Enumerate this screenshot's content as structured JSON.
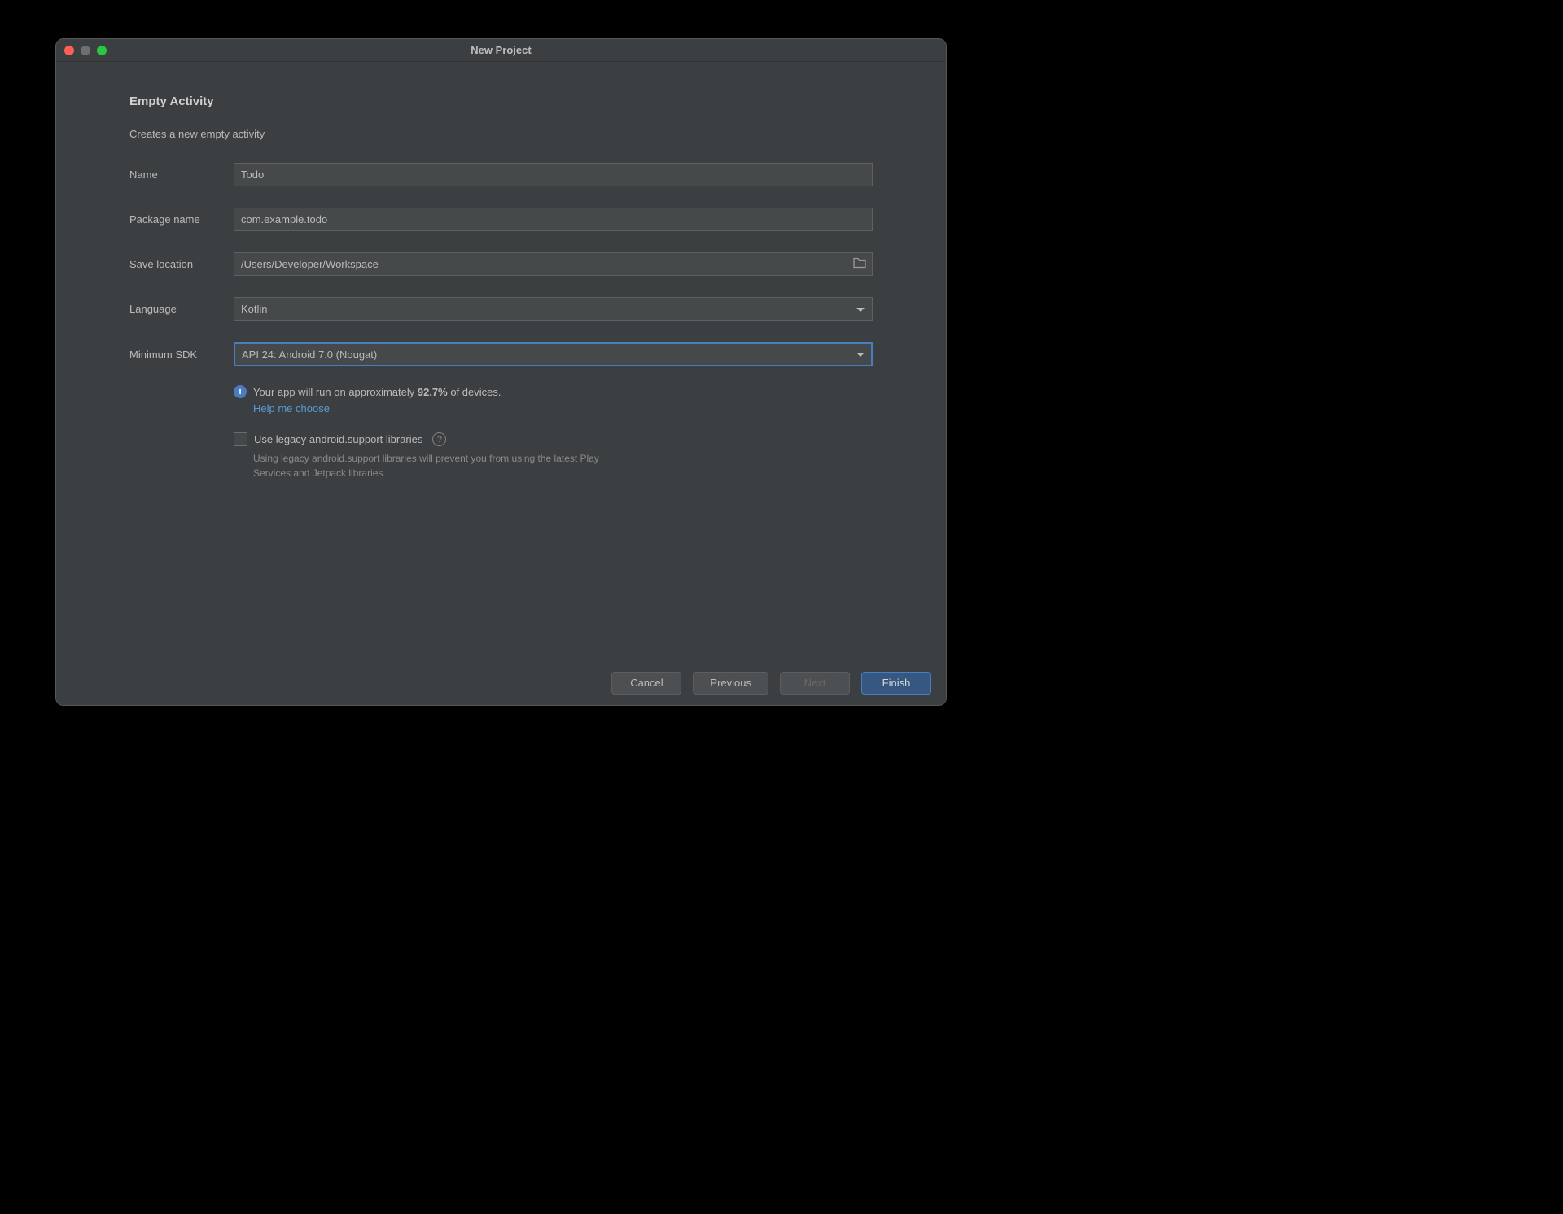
{
  "window": {
    "title": "New Project"
  },
  "header": {
    "heading": "Empty Activity",
    "subheading": "Creates a new empty activity"
  },
  "form": {
    "name_label": "Name",
    "name_value": "Todo",
    "package_label": "Package name",
    "package_value": "com.example.todo",
    "location_label": "Save location",
    "location_value": "/Users/Developer/Workspace",
    "language_label": "Language",
    "language_value": "Kotlin",
    "min_sdk_label": "Minimum SDK",
    "min_sdk_value": "API 24: Android 7.0 (Nougat)"
  },
  "info": {
    "text_before": "Your app will run on approximately ",
    "percent": "92.7%",
    "text_after": " of devices.",
    "help_link": "Help me choose"
  },
  "legacy": {
    "checkbox_label": "Use legacy android.support libraries",
    "checked": false,
    "desc": "Using legacy android.support libraries will prevent you from using the latest Play Services and Jetpack libraries"
  },
  "footer": {
    "cancel": "Cancel",
    "previous": "Previous",
    "next": "Next",
    "finish": "Finish"
  }
}
